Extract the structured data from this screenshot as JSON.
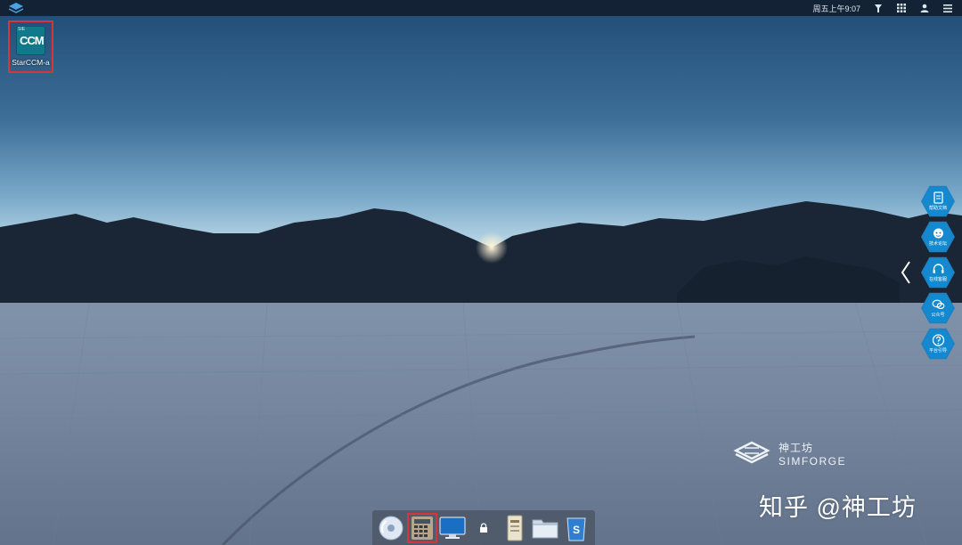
{
  "topbar": {
    "clock": "周五上午9:07",
    "icons": [
      "logo-icon",
      "brightness-icon",
      "apps-grid-icon",
      "user-icon",
      "menu-icon"
    ]
  },
  "desktop": {
    "icons": [
      {
        "label": "StarCCM-a",
        "tile_small": "SIE",
        "tile_text": "CCM",
        "icon": "starccm-app-icon",
        "selected": true
      }
    ]
  },
  "side_panel": {
    "items": [
      {
        "label": "帮助文档",
        "icon": "document-icon"
      },
      {
        "label": "技术论坛",
        "icon": "forum-icon"
      },
      {
        "label": "在线客服",
        "icon": "headset-icon"
      },
      {
        "label": "公众号",
        "icon": "wechat-icon"
      },
      {
        "label": "平台引导",
        "icon": "question-icon"
      }
    ]
  },
  "brand": {
    "cn": "神工坊",
    "en": "SIMFORGE"
  },
  "watermark": "知乎 @神工坊",
  "dock": {
    "items": [
      {
        "name": "disc-icon"
      },
      {
        "name": "calculator-icon",
        "active": true
      },
      {
        "name": "monitor-icon"
      },
      {
        "name": "lock-icon"
      },
      {
        "name": "notebook-icon"
      },
      {
        "name": "folder-icon"
      },
      {
        "name": "storage-icon"
      }
    ]
  },
  "colors": {
    "accent": "#1489d0",
    "highlight": "#d6353a",
    "topbar": "#122030"
  }
}
